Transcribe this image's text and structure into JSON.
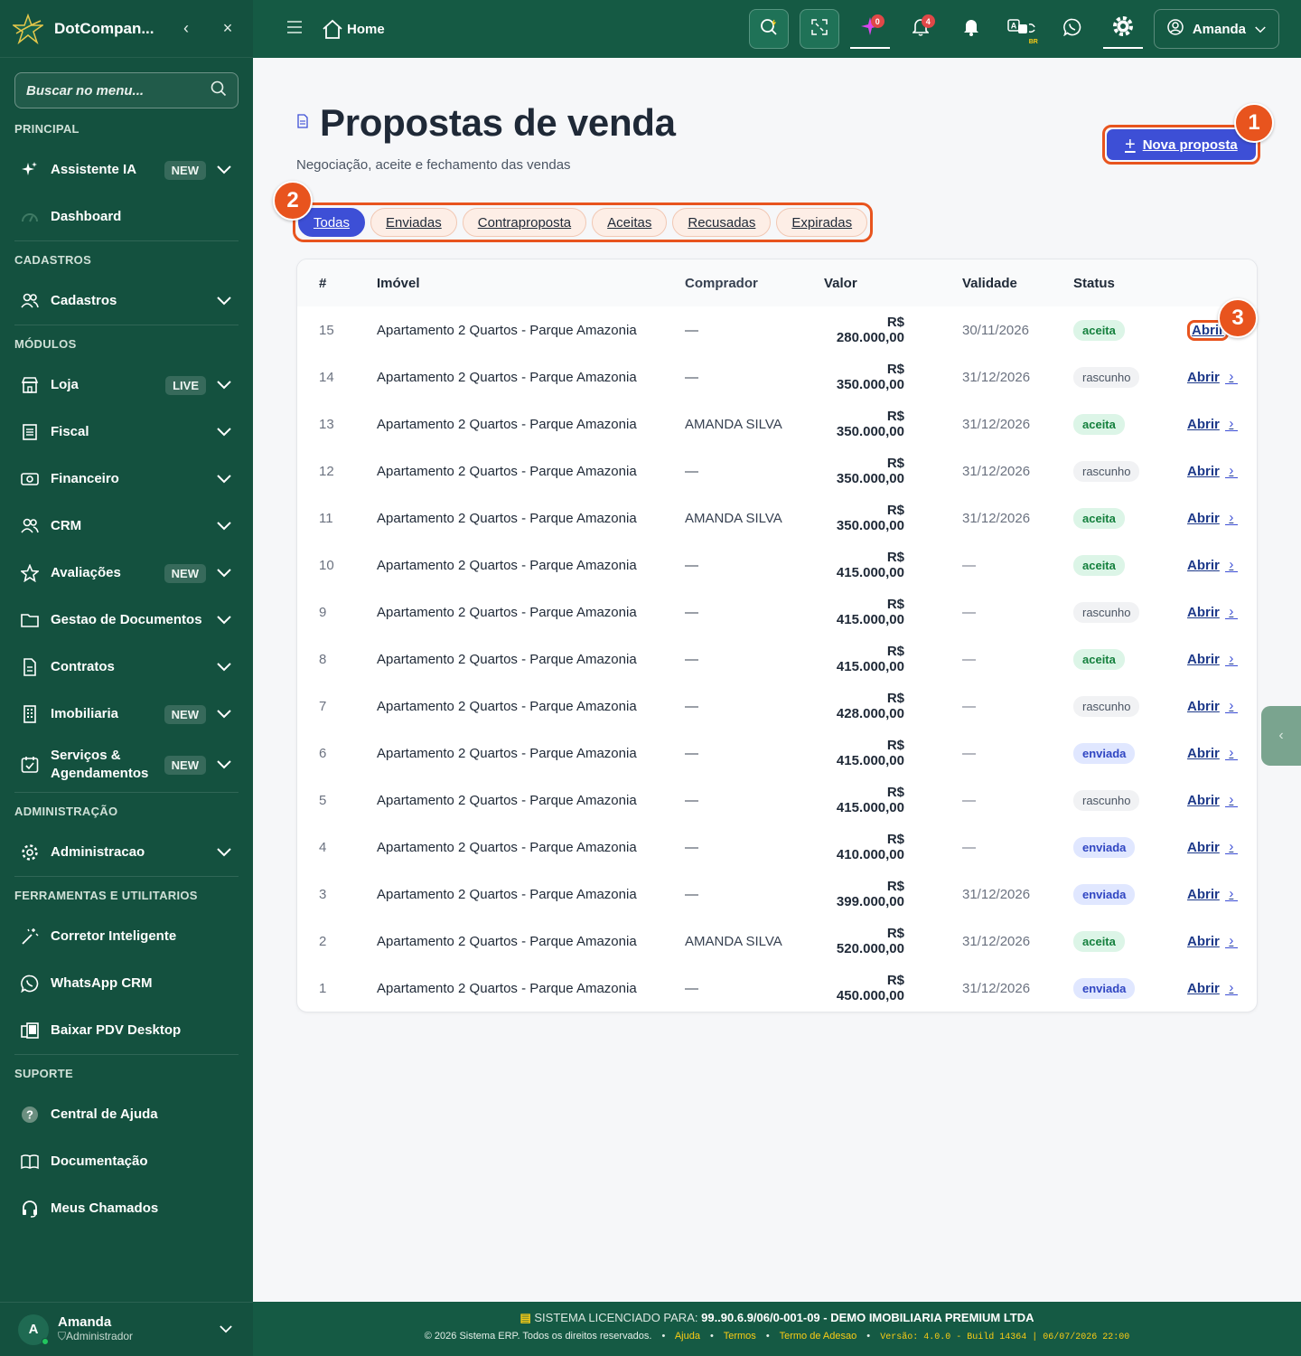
{
  "sidebar": {
    "brand": "DotCompan...",
    "search_placeholder": "Buscar no menu...",
    "sections": {
      "principal": "PRINCIPAL",
      "cadastros": "CADASTROS",
      "modulos": "MÓDULOS",
      "administracao": "ADMINISTRAÇÃO",
      "ferramentas": "FERRAMENTAS E UTILITARIOS",
      "suporte": "SUPORTE"
    },
    "items": {
      "assistente": {
        "label": "Assistente IA",
        "badge": "NEW"
      },
      "dashboard": {
        "label": "Dashboard"
      },
      "cadastros": {
        "label": "Cadastros"
      },
      "loja": {
        "label": "Loja",
        "badge": "LIVE"
      },
      "fiscal": {
        "label": "Fiscal"
      },
      "financeiro": {
        "label": "Financeiro"
      },
      "crm": {
        "label": "CRM"
      },
      "avaliacoes": {
        "label": "Avaliações",
        "badge": "NEW"
      },
      "documentos": {
        "label": "Gestao de Documentos"
      },
      "contratos": {
        "label": "Contratos"
      },
      "imobiliaria": {
        "label": "Imobiliaria",
        "badge": "NEW"
      },
      "servicos": {
        "label_1": "Serviços &",
        "label_2": "Agendamentos",
        "badge": "NEW"
      },
      "administracao": {
        "label": "Administracao"
      },
      "corretor": {
        "label": "Corretor Inteligente"
      },
      "whatsapp": {
        "label": "WhatsApp CRM"
      },
      "pdv": {
        "label": "Baixar PDV Desktop"
      },
      "ajuda": {
        "label": "Central de Ajuda"
      },
      "documentacao": {
        "label": "Documentação"
      },
      "chamados": {
        "label": "Meus Chamados"
      }
    },
    "user": {
      "initial": "A",
      "name": "Amanda",
      "role": "Administrador"
    }
  },
  "topbar": {
    "home_label": "Home",
    "ai_count": "0",
    "notif_count": "4",
    "lang_tag": "BR",
    "user_label": "Amanda"
  },
  "page": {
    "title": "Propostas de venda",
    "subtitle": "Negociação, aceite e fechamento das vendas",
    "new_button": "Nova proposta",
    "markers": [
      "1",
      "2",
      "3"
    ],
    "filters": [
      "Todas",
      "Enviadas",
      "Contraproposta",
      "Aceitas",
      "Recusadas",
      "Expiradas"
    ],
    "active_filter": "Todas"
  },
  "table": {
    "headers": {
      "num": "#",
      "imovel": "Imóvel",
      "comprador": "Comprador",
      "valor": "Valor",
      "validade": "Validade",
      "status": "Status"
    },
    "action_label": "Abrir",
    "rows": [
      {
        "num": "15",
        "imovel": "Apartamento 2 Quartos - Parque Amazonia",
        "comprador": "—",
        "valor": "R$ 280.000,00",
        "validade": "30/11/2026",
        "status": "aceita"
      },
      {
        "num": "14",
        "imovel": "Apartamento 2 Quartos - Parque Amazonia",
        "comprador": "—",
        "valor": "R$ 350.000,00",
        "validade": "31/12/2026",
        "status": "rascunho"
      },
      {
        "num": "13",
        "imovel": "Apartamento 2 Quartos - Parque Amazonia",
        "comprador": "AMANDA SILVA",
        "valor": "R$ 350.000,00",
        "validade": "31/12/2026",
        "status": "aceita"
      },
      {
        "num": "12",
        "imovel": "Apartamento 2 Quartos - Parque Amazonia",
        "comprador": "—",
        "valor": "R$ 350.000,00",
        "validade": "31/12/2026",
        "status": "rascunho"
      },
      {
        "num": "11",
        "imovel": "Apartamento 2 Quartos - Parque Amazonia",
        "comprador": "AMANDA SILVA",
        "valor": "R$ 350.000,00",
        "validade": "31/12/2026",
        "status": "aceita"
      },
      {
        "num": "10",
        "imovel": "Apartamento 2 Quartos - Parque Amazonia",
        "comprador": "—",
        "valor": "R$ 415.000,00",
        "validade": "—",
        "status": "aceita"
      },
      {
        "num": "9",
        "imovel": "Apartamento 2 Quartos - Parque Amazonia",
        "comprador": "—",
        "valor": "R$ 415.000,00",
        "validade": "—",
        "status": "rascunho"
      },
      {
        "num": "8",
        "imovel": "Apartamento 2 Quartos - Parque Amazonia",
        "comprador": "—",
        "valor": "R$ 415.000,00",
        "validade": "—",
        "status": "aceita"
      },
      {
        "num": "7",
        "imovel": "Apartamento 2 Quartos - Parque Amazonia",
        "comprador": "—",
        "valor": "R$ 428.000,00",
        "validade": "—",
        "status": "rascunho"
      },
      {
        "num": "6",
        "imovel": "Apartamento 2 Quartos - Parque Amazonia",
        "comprador": "—",
        "valor": "R$ 415.000,00",
        "validade": "—",
        "status": "enviada"
      },
      {
        "num": "5",
        "imovel": "Apartamento 2 Quartos - Parque Amazonia",
        "comprador": "—",
        "valor": "R$ 415.000,00",
        "validade": "—",
        "status": "rascunho"
      },
      {
        "num": "4",
        "imovel": "Apartamento 2 Quartos - Parque Amazonia",
        "comprador": "—",
        "valor": "R$ 410.000,00",
        "validade": "—",
        "status": "enviada"
      },
      {
        "num": "3",
        "imovel": "Apartamento 2 Quartos - Parque Amazonia",
        "comprador": "—",
        "valor": "R$ 399.000,00",
        "validade": "31/12/2026",
        "status": "enviada"
      },
      {
        "num": "2",
        "imovel": "Apartamento 2 Quartos - Parque Amazonia",
        "comprador": "AMANDA SILVA",
        "valor": "R$ 520.000,00",
        "validade": "31/12/2026",
        "status": "aceita"
      },
      {
        "num": "1",
        "imovel": "Apartamento 2 Quartos - Parque Amazonia",
        "comprador": "—",
        "valor": "R$ 450.000,00",
        "validade": "31/12/2026",
        "status": "enviada"
      }
    ]
  },
  "footer": {
    "license_label": "SISTEMA LICENCIADO PARA:",
    "license_value": "99..90.6.9/06/0-001-09 - DEMO IMOBILIARIA PREMIUM LTDA",
    "copyright": "© 2026 Sistema ERP. Todos os direitos reservados.",
    "links": [
      "Ajuda",
      "Termos",
      "Termo de Adesao"
    ],
    "version": "Versão: 4.0.0 - Build 14364 | 06/07/2026 22:00"
  },
  "colors": {
    "sidebar": "#14513f",
    "topbar": "#155a44",
    "accent": "#3d4fd6",
    "highlight": "#e8541e"
  }
}
